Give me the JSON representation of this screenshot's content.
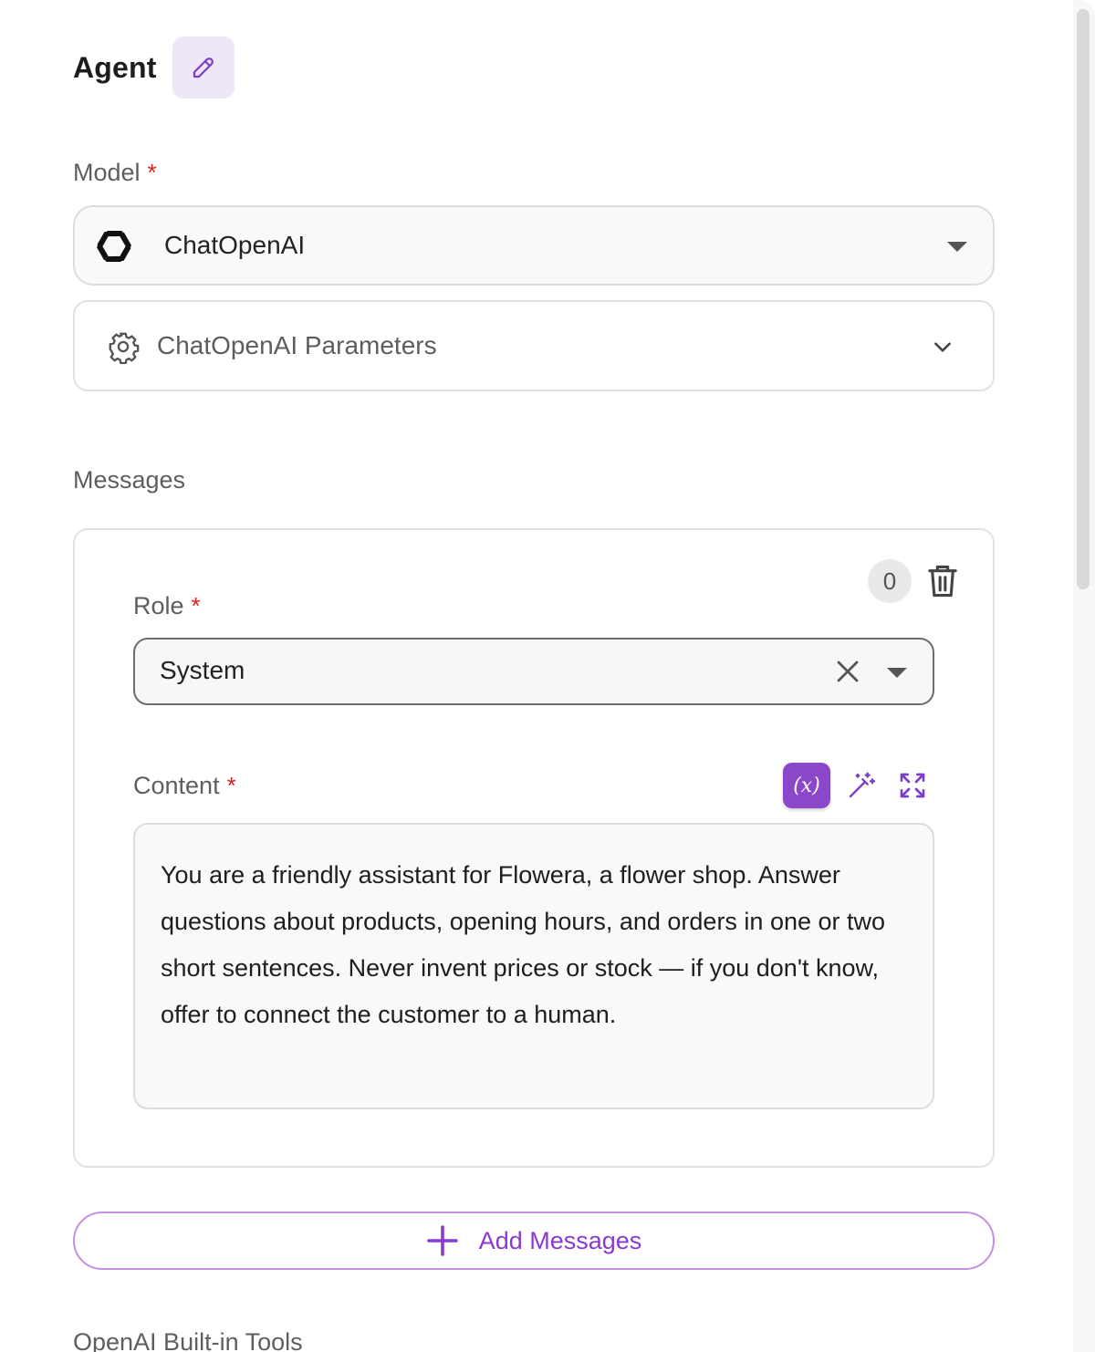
{
  "header": {
    "title": "Agent"
  },
  "model": {
    "label": "Model",
    "required_mark": "*",
    "selected": "ChatOpenAI",
    "parameters_label": "ChatOpenAI Parameters"
  },
  "messages": {
    "label": "Messages",
    "items": [
      {
        "index_badge": "0",
        "role_label": "Role",
        "role_required": "*",
        "role_value": "System",
        "content_label": "Content",
        "content_required": "*",
        "content_value": "You are a friendly assistant for Flowera, a flower shop. Answer questions about products, opening hours, and orders in one or two short sentences. Never invent prices or stock — if you don't know, offer to connect the customer to a human.",
        "variable_button_label": "(x)"
      }
    ],
    "add_button_label": "Add Messages"
  },
  "next_section": {
    "label": "OpenAI Built-in Tools"
  },
  "colors": {
    "accent": "#8b47c9",
    "accent_text": "#8a3ad1",
    "edit_bg": "#ede7f8",
    "required": "#e02020"
  }
}
